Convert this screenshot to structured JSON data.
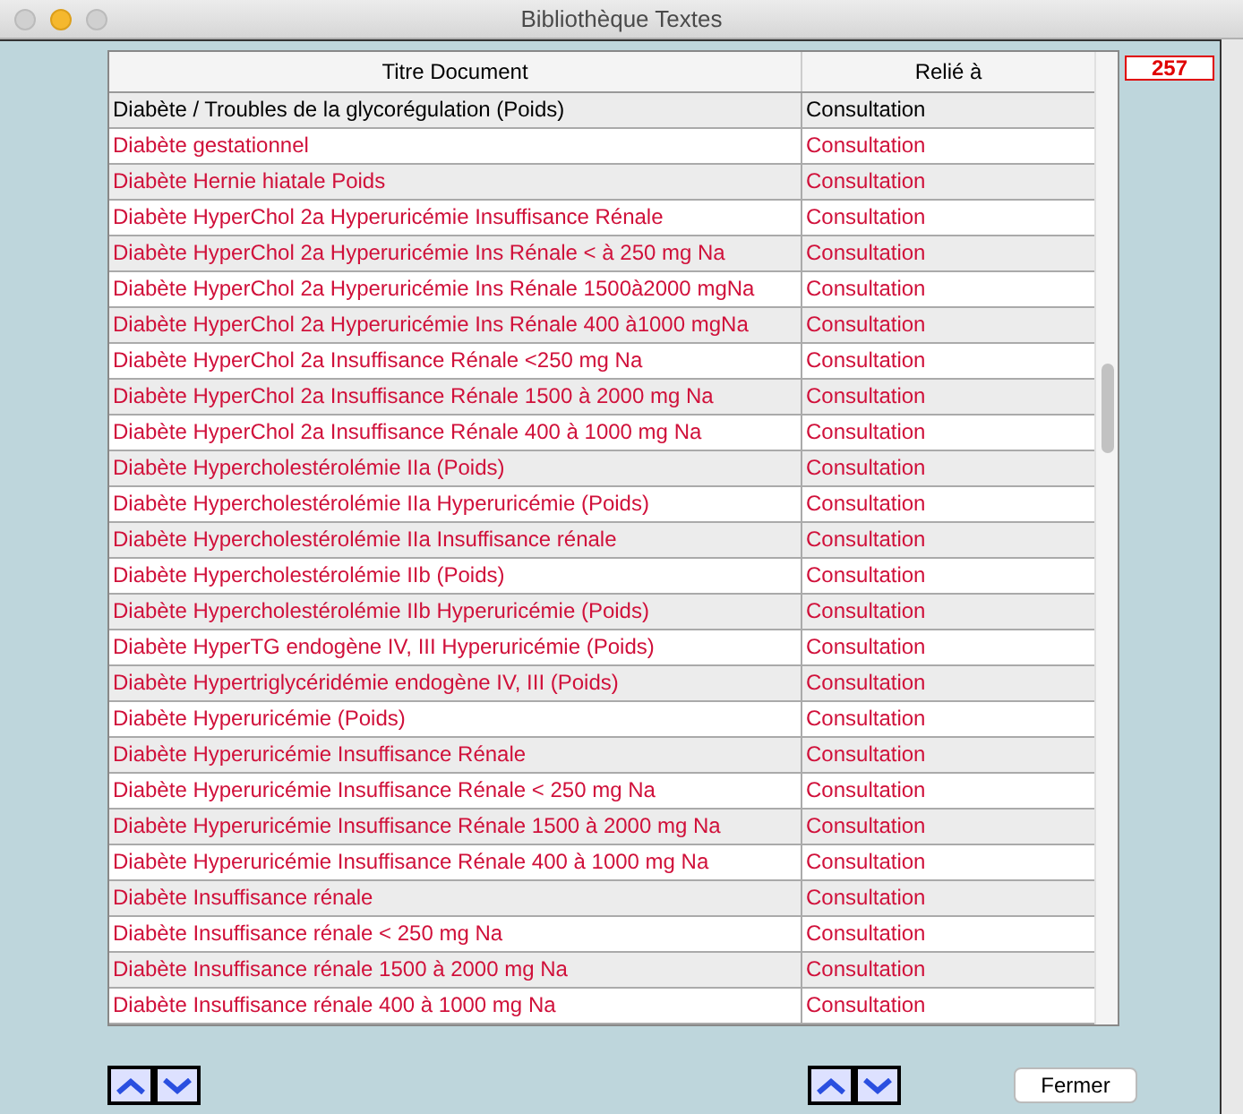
{
  "window": {
    "title": "Bibliothèque Textes"
  },
  "table": {
    "columns": [
      "Titre Document",
      "Relié à"
    ],
    "rows": [
      {
        "title": "Diabète / Troubles de la glycorégulation (Poids)",
        "linked": "Consultation",
        "color": "#000000"
      },
      {
        "title": "Diabète gestationnel",
        "linked": "Consultation",
        "color": "#d0103a"
      },
      {
        "title": "Diabète Hernie hiatale Poids",
        "linked": "Consultation",
        "color": "#d0103a"
      },
      {
        "title": "Diabète HyperChol 2a Hyperuricémie  Insuffisance Rénale",
        "linked": "Consultation",
        "color": "#d0103a"
      },
      {
        "title": "Diabète HyperChol 2a Hyperuricémie Ins Rénale < à 250 mg Na",
        "linked": "Consultation",
        "color": "#d0103a"
      },
      {
        "title": "Diabète HyperChol 2a Hyperuricémie Ins Rénale 1500à2000 mgNa",
        "linked": "Consultation",
        "color": "#d0103a"
      },
      {
        "title": "Diabète HyperChol 2a Hyperuricémie Ins Rénale 400 à1000 mgNa",
        "linked": "Consultation",
        "color": "#d0103a"
      },
      {
        "title": "Diabète HyperChol 2a Insuffisance Rénale <250 mg Na",
        "linked": "Consultation",
        "color": "#d0103a"
      },
      {
        "title": "Diabète HyperChol 2a Insuffisance Rénale 1500 à 2000 mg Na",
        "linked": "Consultation",
        "color": "#d0103a"
      },
      {
        "title": "Diabète HyperChol 2a Insuffisance Rénale 400 à 1000 mg Na",
        "linked": "Consultation",
        "color": "#d0103a"
      },
      {
        "title": "Diabète Hypercholestérolémie IIa (Poids)",
        "linked": "Consultation",
        "color": "#d0103a"
      },
      {
        "title": "Diabète Hypercholestérolémie IIa Hyperuricémie (Poids)",
        "linked": "Consultation",
        "color": "#d0103a"
      },
      {
        "title": "Diabète Hypercholestérolémie IIa Insuffisance rénale",
        "linked": "Consultation",
        "color": "#d0103a"
      },
      {
        "title": "Diabète Hypercholestérolémie IIb (Poids)",
        "linked": "Consultation",
        "color": "#d0103a"
      },
      {
        "title": "Diabète Hypercholestérolémie IIb Hyperuricémie (Poids)",
        "linked": "Consultation",
        "color": "#d0103a"
      },
      {
        "title": "Diabète HyperTG endogène IV, III Hyperuricémie (Poids)",
        "linked": "Consultation",
        "color": "#d0103a"
      },
      {
        "title": "Diabète Hypertriglycéridémie endogène IV, III (Poids)",
        "linked": "Consultation",
        "color": "#d0103a"
      },
      {
        "title": "Diabète Hyperuricémie (Poids)",
        "linked": "Consultation",
        "color": "#d0103a"
      },
      {
        "title": "Diabète Hyperuricémie Insuffisance Rénale",
        "linked": "Consultation",
        "color": "#d0103a"
      },
      {
        "title": "Diabète Hyperuricémie Insuffisance Rénale < 250 mg Na",
        "linked": "Consultation",
        "color": "#d0103a"
      },
      {
        "title": "Diabète Hyperuricémie Insuffisance Rénale 1500 à 2000 mg Na",
        "linked": "Consultation",
        "color": "#d0103a"
      },
      {
        "title": "Diabète Hyperuricémie Insuffisance Rénale 400 à 1000 mg Na",
        "linked": "Consultation",
        "color": "#d0103a"
      },
      {
        "title": "Diabète Insuffisance rénale",
        "linked": "Consultation",
        "color": "#d0103a"
      },
      {
        "title": "Diabète Insuffisance rénale < 250 mg Na",
        "linked": "Consultation",
        "color": "#d0103a"
      },
      {
        "title": "Diabète Insuffisance rénale 1500 à 2000 mg Na",
        "linked": "Consultation",
        "color": "#d0103a"
      },
      {
        "title": "Diabète Insuffisance rénale 400 à 1000 mg Na",
        "linked": "Consultation",
        "color": "#d0103a"
      }
    ]
  },
  "count": "257",
  "buttons": {
    "close": "Fermer"
  }
}
